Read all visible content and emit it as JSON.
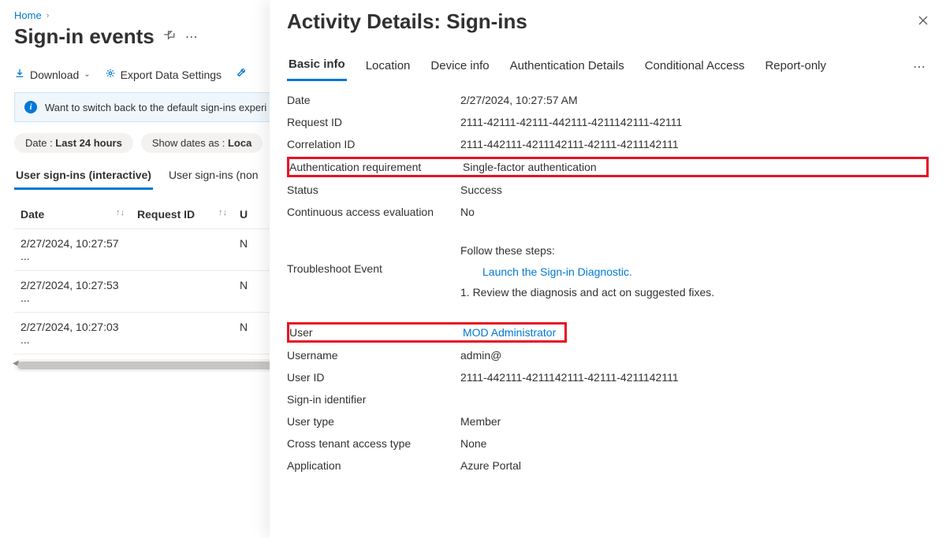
{
  "breadcrumb": {
    "home": "Home"
  },
  "page": {
    "title": "Sign-in events"
  },
  "toolbar": {
    "download": "Download",
    "export_settings": "Export Data Settings"
  },
  "infoBar": {
    "text": "Want to switch back to the default sign-ins experi"
  },
  "filters": {
    "date_label": "Date : ",
    "date_value": "Last 24 hours",
    "showdates_label": "Show dates as : ",
    "showdates_value": "Loca"
  },
  "tabs": {
    "t1": "User sign-ins (interactive)",
    "t2": "User sign-ins (non"
  },
  "table": {
    "head_date": "Date",
    "head_request": "Request ID",
    "rows": [
      {
        "date": "2/27/2024, 10:27:57 ...",
        "flag": "N"
      },
      {
        "date": "2/27/2024, 10:27:53 ...",
        "flag": "N"
      },
      {
        "date": "2/27/2024, 10:27:03 ...",
        "flag": "N"
      }
    ]
  },
  "panel": {
    "title": "Activity Details: Sign-ins",
    "tabs": {
      "basic": "Basic info",
      "location": "Location",
      "device": "Device info",
      "auth": "Authentication Details",
      "conditional": "Conditional Access",
      "report": "Report-only"
    },
    "rows": {
      "date_k": "Date",
      "date_v": "2/27/2024, 10:27:57 AM",
      "req_k": "Request ID",
      "req_v": "2111-42111-42111-442111-4211142111-42111",
      "corr_k": "Correlation ID",
      "corr_v": "2111-442111-4211142111-42111-4211142111",
      "authreq_k": "Authentication requirement",
      "authreq_v": "Single-factor authentication",
      "status_k": "Status",
      "status_v": "Success",
      "cae_k": "Continuous access evaluation",
      "cae_v": "No",
      "trouble_k": "Troubleshoot Event",
      "trouble_intro": "Follow these steps:",
      "trouble_link": "Launch the Sign-in Diagnostic.",
      "trouble_step": "1. Review the diagnosis and act on suggested fixes.",
      "user_k": "User",
      "user_v": "MOD Administrator",
      "username_k": "Username",
      "username_v": "admin@",
      "userid_k": "User ID",
      "userid_v": "2111-442111-4211142111-42111-4211142111",
      "signin_k": "Sign-in identifier",
      "signin_v": "",
      "usertype_k": "User type",
      "usertype_v": "Member",
      "cross_k": "Cross tenant access type",
      "cross_v": "None",
      "app_k": "Application",
      "app_v": "Azure Portal"
    }
  }
}
